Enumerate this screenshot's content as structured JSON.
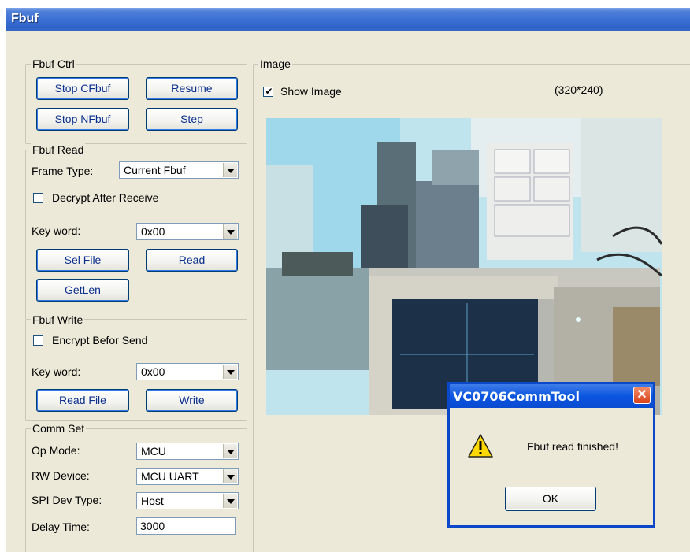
{
  "window": {
    "title": "Fbuf"
  },
  "fbuf_ctrl": {
    "legend": "Fbuf Ctrl",
    "stop_cfbuf": "Stop CFbuf",
    "resume": "Resume",
    "stop_nfbuf": "Stop NFbuf",
    "step": "Step"
  },
  "fbuf_read": {
    "legend": "Fbuf Read",
    "frame_type_label": "Frame Type:",
    "frame_type_value": "Current Fbuf",
    "decrypt_label": "Decrypt After Receive",
    "decrypt_checked": false,
    "key_word_label": "Key word:",
    "key_word_value": "0x00",
    "sel_file": "Sel File",
    "read": "Read",
    "get_len": "GetLen"
  },
  "fbuf_write": {
    "legend": "Fbuf Write",
    "encrypt_label": "Encrypt Befor Send",
    "encrypt_checked": false,
    "key_word_label": "Key word:",
    "key_word_value": "0x00",
    "read_file": "Read File",
    "write": "Write"
  },
  "comm_set": {
    "legend": "Comm Set",
    "op_mode_label": "Op Mode:",
    "op_mode_value": "MCU",
    "rw_device_label": "RW Device:",
    "rw_device_value": "MCU UART",
    "spi_dev_type_label": "SPI Dev Type:",
    "spi_dev_type_value": "Host",
    "delay_time_label": "Delay Time:",
    "delay_time_value": "3000"
  },
  "image": {
    "legend": "Image",
    "show_image_label": "Show Image",
    "show_image_checked": true,
    "resolution": "(320*240)"
  },
  "dialog": {
    "title": "VC0706CommTool",
    "message": "Fbuf read finished!",
    "ok": "OK",
    "icon": "warning-icon"
  },
  "colors": {
    "titlebar": "#3b6fd3",
    "dialog_border": "#0a47c9",
    "button_text": "#0a2f8c",
    "window_bg": "#ece9d8"
  }
}
